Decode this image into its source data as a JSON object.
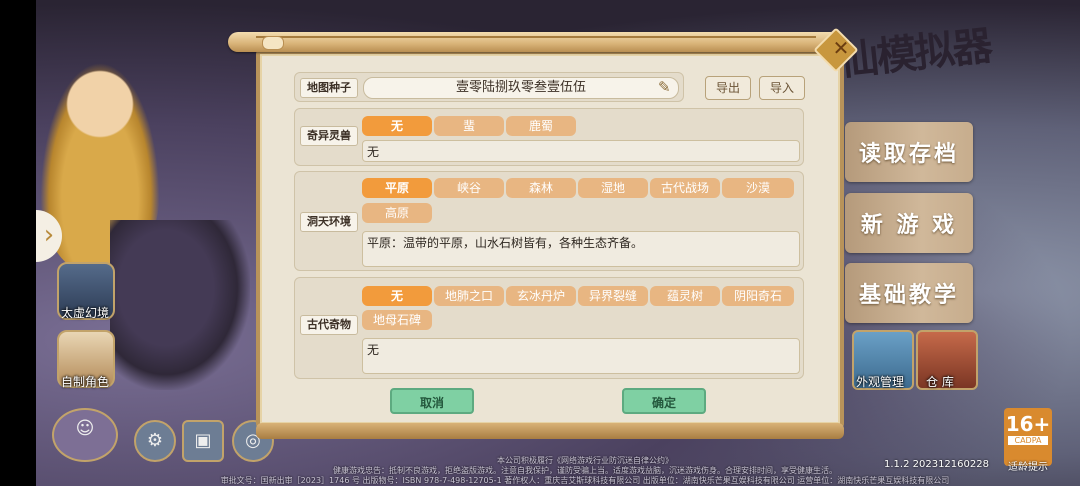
{
  "side": {
    "taixu_label": "太虚幻境",
    "custom_role_label": "自制角色"
  },
  "right_menu": {
    "load_label": "读取存档",
    "new_game_label": "新 游 戏",
    "tutorial_label": "基础教学",
    "appearance_label": "外观管理",
    "warehouse_label": "仓 库"
  },
  "logo_text": "仙模拟器",
  "age_rating": {
    "value": "16+",
    "org": "CADPA",
    "tip": "适龄提示"
  },
  "version": "1.1.2 202312160228",
  "footer": {
    "line1": "本公司积极履行《网络游戏行业防沉迷自律公约》",
    "line2": "健康游戏忠告：抵制不良游戏，拒绝盗版游戏。注意自我保护，谨防受骗上当。适度游戏益脑，沉迷游戏伤身。合理安排时间，享受健康生活。",
    "line3": "审批文号：国新出审［2023］1746 号 出版物号：ISBN 978-7-498-12705-1 著作权人：重庆吉艾斯球科技有限公司 出版单位：湖南快乐芒果互娱科技有限公司 运营单位：湖南快乐芒果互娱科技有限公司"
  },
  "dialog": {
    "seed_label": "地图种子",
    "seed_value": "壹零陆捌玖零叁壹伍伍",
    "export_label": "导出",
    "import_label": "导入",
    "beast": {
      "label": "奇异灵兽",
      "options": [
        "无",
        "蜚",
        "鹿蜀"
      ],
      "selected": 0,
      "description": "无"
    },
    "environment": {
      "label": "洞天环境",
      "options": [
        "平原",
        "峡谷",
        "森林",
        "湿地",
        "古代战场",
        "沙漠",
        "高原"
      ],
      "selected": 0,
      "description": "平原：温带的平原，山水石树皆有，各种生态齐备。"
    },
    "relic": {
      "label": "古代奇物",
      "options": [
        "无",
        "地肺之口",
        "玄冰丹炉",
        "异界裂缝",
        "蕴灵树",
        "阴阳奇石",
        "地母石碑"
      ],
      "selected": 0,
      "description": "无"
    },
    "cancel_label": "取消",
    "confirm_label": "确定"
  },
  "colors": {
    "option_selected": "#f29b3c",
    "option_normal": "#e8b682",
    "action_button": "#7fd0a3"
  }
}
